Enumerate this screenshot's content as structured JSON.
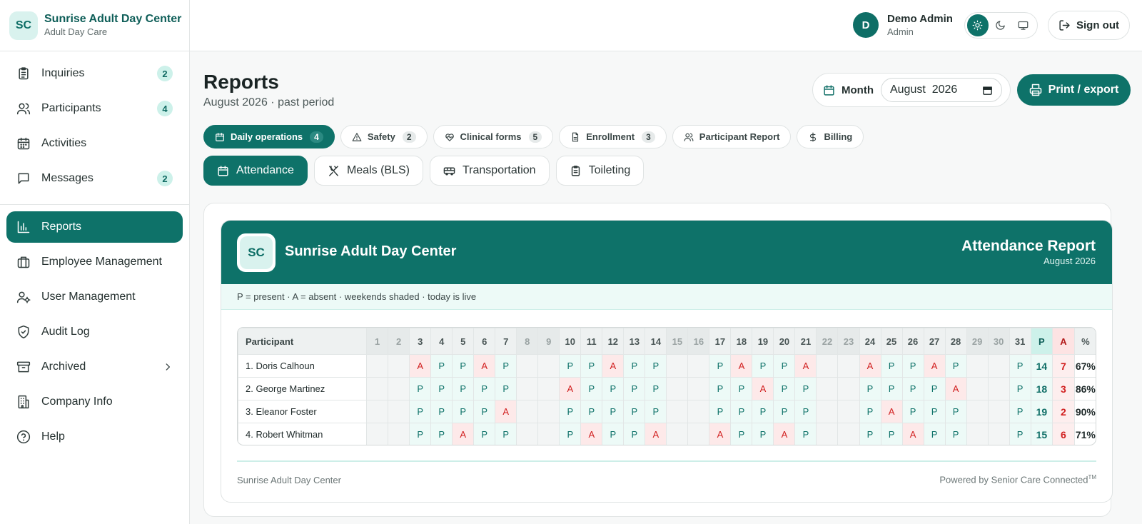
{
  "brand": {
    "initials": "SC",
    "name": "Sunrise Adult Day Center",
    "subtitle": "Adult Day Care"
  },
  "sidebar": {
    "items": [
      {
        "label": "Inquiries",
        "icon": "clipboard-icon",
        "count": "2"
      },
      {
        "label": "Participants",
        "icon": "users-icon",
        "count": "4"
      },
      {
        "label": "Activities",
        "icon": "calendar-icon",
        "count": ""
      },
      {
        "label": "Messages",
        "icon": "message-icon",
        "count": "2"
      },
      {
        "label": "Reports",
        "icon": "bar-chart-icon",
        "active": true
      },
      {
        "label": "Employee Management",
        "icon": "briefcase-icon"
      },
      {
        "label": "User Management",
        "icon": "user-cog-icon"
      },
      {
        "label": "Audit Log",
        "icon": "shield-icon"
      },
      {
        "label": "Archived",
        "icon": "archive-icon"
      },
      {
        "label": "Company Info",
        "icon": "building-icon"
      },
      {
        "label": "Help",
        "icon": "help-icon"
      }
    ]
  },
  "user": {
    "initial": "D",
    "name": "Demo Admin",
    "role": "Admin"
  },
  "header": {
    "sign_out": "Sign out"
  },
  "page": {
    "title": "Reports",
    "subtitle": "August 2026 · past period",
    "month_label": "Month",
    "month_value": "August  2026",
    "print_label": "Print / export"
  },
  "tabs": [
    {
      "label": "Daily operations",
      "count": "4",
      "icon": "calendar-icon",
      "active": true
    },
    {
      "label": "Safety",
      "count": "2",
      "icon": "warning-icon"
    },
    {
      "label": "Clinical forms",
      "count": "5",
      "icon": "heart-pulse-icon"
    },
    {
      "label": "Enrollment",
      "count": "3",
      "icon": "file-icon"
    },
    {
      "label": "Participant Report",
      "count": "",
      "icon": "users-icon"
    },
    {
      "label": "Billing",
      "count": "",
      "icon": "dollar-icon"
    }
  ],
  "subtabs": [
    {
      "label": "Attendance",
      "icon": "calendar-icon",
      "active": true
    },
    {
      "label": "Meals (BLS)",
      "icon": "utensils-icon"
    },
    {
      "label": "Transportation",
      "icon": "bus-icon"
    },
    {
      "label": "Toileting",
      "icon": "clipboard-icon"
    }
  ],
  "report": {
    "org_initials": "SC",
    "org_name": "Sunrise Adult Day Center",
    "title": "Attendance Report",
    "period": "August 2026",
    "legend": "P = present · A = absent · weekends shaded · today is live",
    "participant_header": "Participant",
    "weekend_days": [
      1,
      2,
      8,
      9,
      15,
      16,
      22,
      23,
      29,
      30
    ],
    "summary_headers": [
      "P",
      "A",
      "%"
    ],
    "rows": [
      {
        "name": "1. Doris Calhoun",
        "marks": [
          "",
          "",
          "A",
          "P",
          "P",
          "A",
          "P",
          "",
          "",
          "P",
          "P",
          "A",
          "P",
          "P",
          "",
          "",
          "P",
          "A",
          "P",
          "P",
          "A",
          "",
          "",
          "A",
          "P",
          "P",
          "A",
          "P",
          "",
          "",
          "P"
        ],
        "present": "14",
        "absent": "7",
        "pct": "67%"
      },
      {
        "name": "2. George Martinez",
        "marks": [
          "",
          "",
          "P",
          "P",
          "P",
          "P",
          "P",
          "",
          "",
          "A",
          "P",
          "P",
          "P",
          "P",
          "",
          "",
          "P",
          "P",
          "A",
          "P",
          "P",
          "",
          "",
          "P",
          "P",
          "P",
          "P",
          "A",
          "",
          "",
          "P"
        ],
        "present": "18",
        "absent": "3",
        "pct": "86%"
      },
      {
        "name": "3. Eleanor Foster",
        "marks": [
          "",
          "",
          "P",
          "P",
          "P",
          "P",
          "A",
          "",
          "",
          "P",
          "P",
          "P",
          "P",
          "P",
          "",
          "",
          "P",
          "P",
          "P",
          "P",
          "P",
          "",
          "",
          "P",
          "A",
          "P",
          "P",
          "P",
          "",
          "",
          "P"
        ],
        "present": "19",
        "absent": "2",
        "pct": "90%"
      },
      {
        "name": "4. Robert Whitman",
        "marks": [
          "",
          "",
          "P",
          "P",
          "A",
          "P",
          "P",
          "",
          "",
          "P",
          "A",
          "P",
          "P",
          "A",
          "",
          "",
          "A",
          "P",
          "P",
          "A",
          "P",
          "",
          "",
          "P",
          "P",
          "A",
          "P",
          "P",
          "",
          "",
          "P"
        ],
        "present": "15",
        "absent": "6",
        "pct": "71%"
      }
    ],
    "footer_left": "Sunrise Adult Day Center",
    "footer_right": "Powered by Senior Care Connected",
    "footer_tm": "TM"
  },
  "colors": {
    "primary": "#0e7269",
    "present_bg": "#edfaf7",
    "absent_text": "#d11f1f"
  }
}
